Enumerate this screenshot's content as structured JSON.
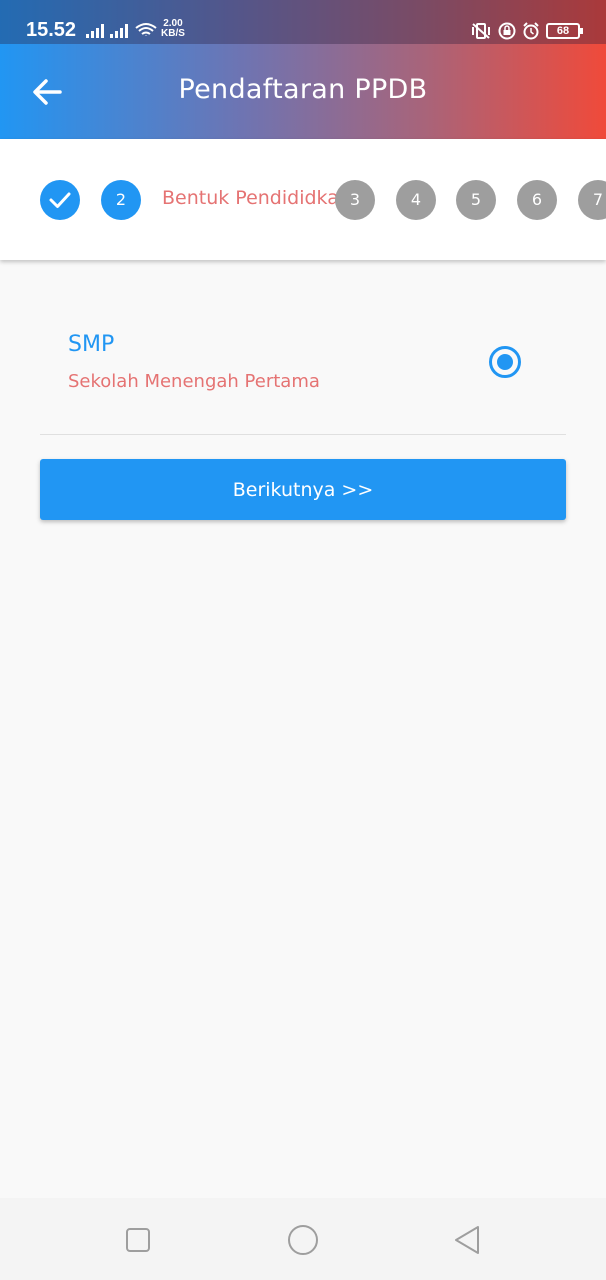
{
  "status_bar": {
    "time": "15.52",
    "net_speed_value": "2.00",
    "net_speed_unit": "KB/S",
    "battery": "68"
  },
  "app_bar": {
    "title": "Pendaftaran PPDB"
  },
  "stepper": {
    "steps": [
      {
        "label": "",
        "state": "done"
      },
      {
        "label": "2",
        "state": "active"
      },
      {
        "label": "3",
        "state": "pending"
      },
      {
        "label": "4",
        "state": "pending"
      },
      {
        "label": "5",
        "state": "pending"
      },
      {
        "label": "6",
        "state": "pending"
      },
      {
        "label": "7",
        "state": "pending"
      }
    ],
    "active_title": "Bentuk Pendididkan"
  },
  "option": {
    "title": "SMP",
    "subtitle": "Sekolah Menengah Pertama",
    "selected": true
  },
  "next_button": {
    "label": "Berikutnya >>"
  },
  "colors": {
    "primary": "#2196f3",
    "accent_text": "#e57373",
    "pending_step": "#9e9e9e"
  }
}
